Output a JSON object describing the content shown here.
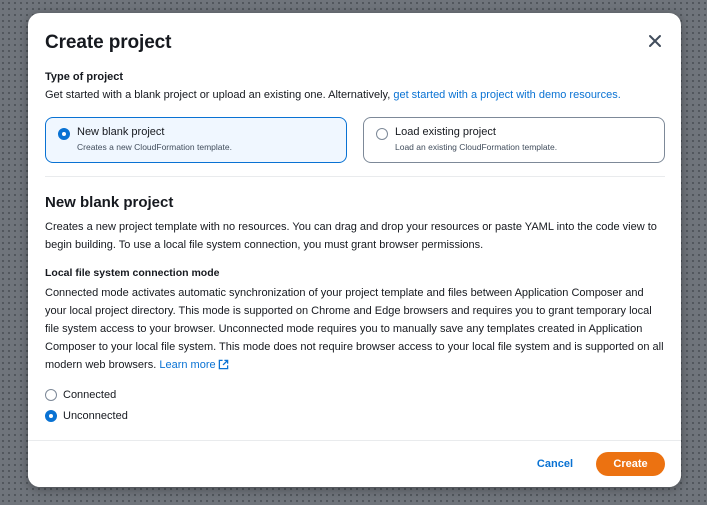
{
  "modal": {
    "title": "Create project",
    "close_icon": "close-icon"
  },
  "project_type": {
    "label": "Type of project",
    "description_prefix": "Get started with a blank project or upload an existing one. Alternatively, ",
    "demo_link": "get started with a project with demo resources.",
    "options": [
      {
        "title": "New blank project",
        "subtitle": "Creates a new CloudFormation template.",
        "selected": true
      },
      {
        "title": "Load existing project",
        "subtitle": "Load an existing CloudFormation template.",
        "selected": false
      }
    ]
  },
  "blank_project": {
    "title": "New blank project",
    "description": "Creates a new project template with no resources. You can drag and drop your resources or paste YAML into the code view to begin building. To use a local file system connection, you must grant browser permissions."
  },
  "connection_mode": {
    "label": "Local file system connection mode",
    "description": "Connected mode activates automatic synchronization of your project template and files between Application Composer and your local project directory. This mode is supported on Chrome and Edge browsers and requires you to grant temporary local file system access to your browser. Unconnected mode requires you to manually save any templates created in Application Composer to your local file system. This mode does not require browser access to your local file system and is supported on all modern web browsers.",
    "learn_more": "Learn more",
    "learn_more_icon": "external-link-icon",
    "options": [
      {
        "label": "Connected",
        "selected": false
      },
      {
        "label": "Unconnected",
        "selected": true
      }
    ]
  },
  "footer": {
    "cancel_label": "Cancel",
    "create_label": "Create"
  },
  "colors": {
    "accent": "#0972d3",
    "primary_button": "#ec7211",
    "text": "#16191f"
  }
}
